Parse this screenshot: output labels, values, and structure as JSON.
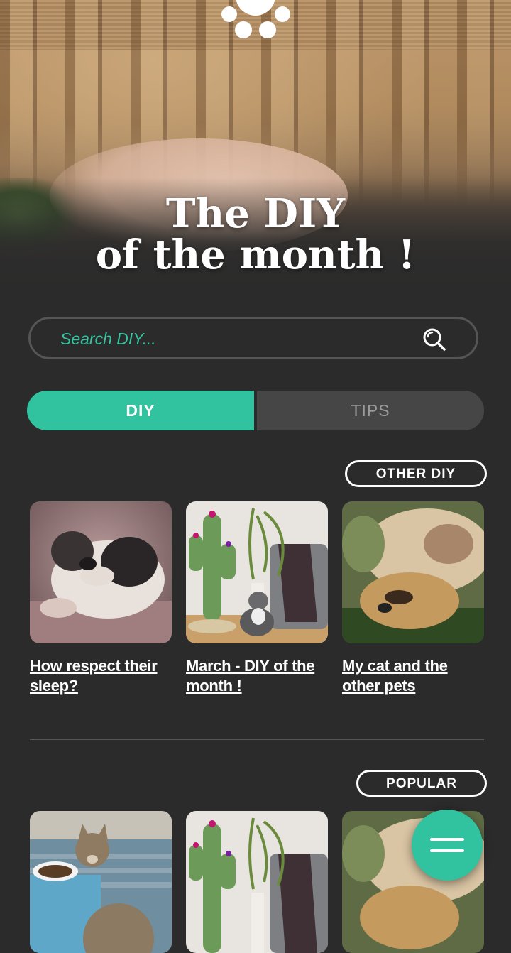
{
  "hero": {
    "title_line1": "The DIY",
    "title_line2": "of the month !"
  },
  "search": {
    "placeholder": "Search DIY..."
  },
  "tabs": [
    {
      "label": "DIY",
      "active": true
    },
    {
      "label": "TIPS",
      "active": false
    }
  ],
  "sections": {
    "other_diy": {
      "label": "OTHER DIY",
      "cards": [
        {
          "title_line1": "How respect their",
          "title_line2": "sleep?",
          "image": "sleeping puppy"
        },
        {
          "title_line1": "March - DIY of the",
          "title_line2": "month !",
          "image": "cactus cat tree with cat"
        },
        {
          "title_line1": "My cat and the",
          "title_line2": "other pets",
          "image": "cat and dog cuddling"
        }
      ]
    },
    "popular": {
      "label": "POPULAR",
      "cards": [
        {
          "image": "tabby cat with food bowls"
        },
        {
          "image": "cactus cat tree"
        },
        {
          "image": "cat and dog cuddling"
        }
      ]
    }
  },
  "colors": {
    "accent": "#31c39f",
    "background": "#2b2b2b",
    "tab_inactive": "#464646"
  },
  "icons": {
    "logo": "paw-icon",
    "search": "search-icon",
    "menu": "menu-icon"
  }
}
